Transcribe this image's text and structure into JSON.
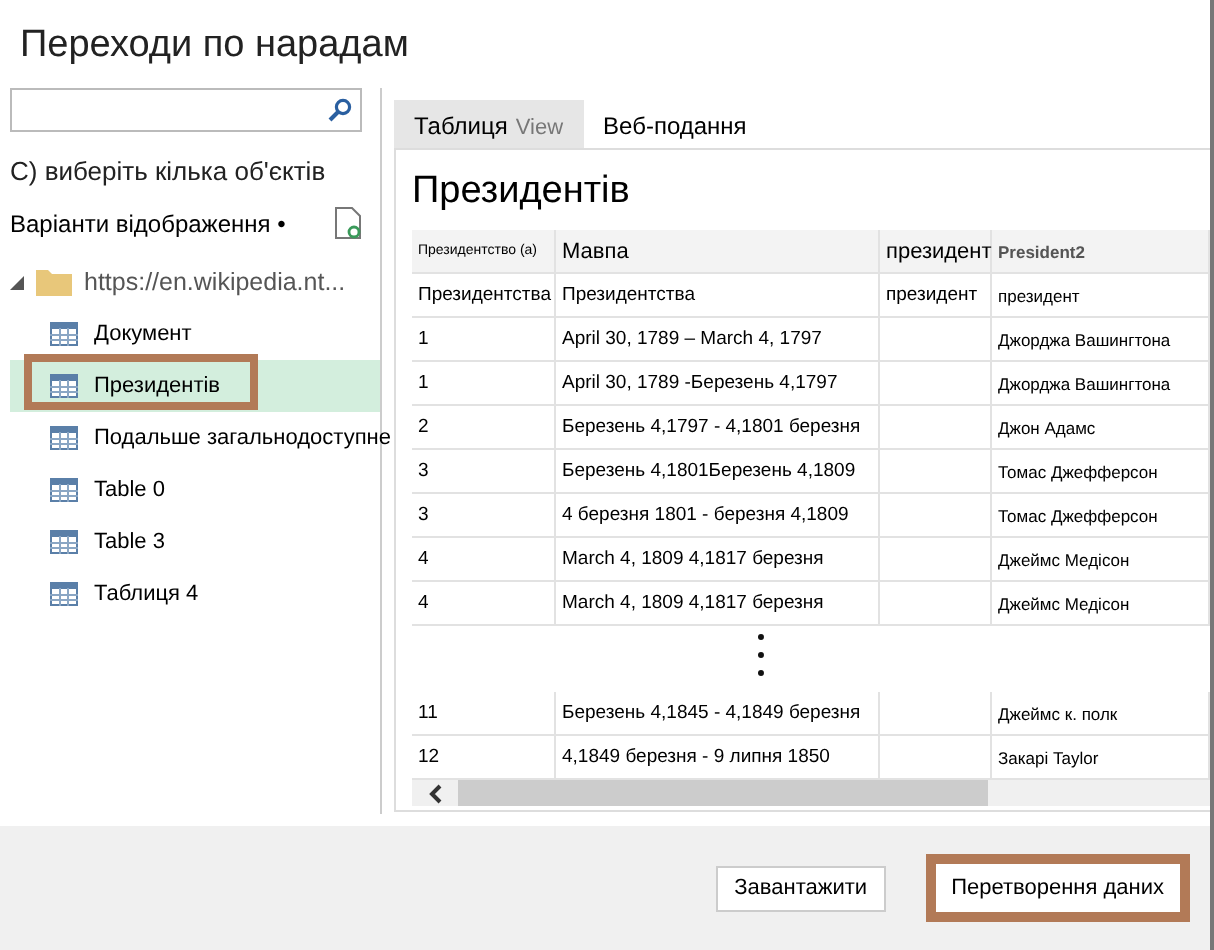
{
  "window": {
    "title": "Переходи по нарадам"
  },
  "select_multiple": "С) виберіть кілька об'єктів",
  "display_options": "Варіанти відображення •",
  "tree": [
    {
      "label": "https://en.wikipedia.nt...",
      "expanded": true,
      "children": [
        {
          "label": "Документ",
          "selected": false
        },
        {
          "label": "Президентів",
          "selected": true
        },
        {
          "label": "Подальше загальнодоступне",
          "selected": false
        },
        {
          "label": "Table 0",
          "selected": false
        },
        {
          "label": "Table 3",
          "selected": false
        },
        {
          "label": "Таблиця 4",
          "selected": false
        }
      ]
    }
  ],
  "tabs": [
    {
      "label": "Таблиця",
      "ghost": "View",
      "selected": true
    },
    {
      "label": "Веб-подання",
      "selected": false
    }
  ],
  "preview_title": "Президентів",
  "table": {
    "columns": [
      "Президентство (а)",
      "Мавпа",
      "президент",
      "President2"
    ],
    "rows": [
      [
        "Президентства",
        "Президентства",
        "президент",
        "президент"
      ],
      [
        "1",
        "April 30, 1789 – March 4, 1797",
        "",
        "Джорджа Вашингтона"
      ],
      [
        "1",
        "April 30, 1789 -Березень 4,1797",
        "",
        "Джорджа Вашингтона"
      ],
      [
        "2",
        "Березень 4,1797 - 4,1801 березня",
        "",
        "Джон Адамс"
      ],
      [
        "3",
        "Березень 4,1801Березень 4,1809",
        "",
        "Томас Джефферсон"
      ],
      [
        "3",
        "4 березня 1801 - березня 4,1809",
        "",
        "Томас Джефферсон"
      ],
      [
        "4",
        "March 4, 1809 4,1817 березня",
        "",
        "Джеймс Медісон"
      ],
      [
        "4",
        "March 4, 1809 4,1817 березня",
        "",
        "Джеймс Медісон"
      ]
    ],
    "more_rows": [
      [
        "11",
        "Березень 4,1845 - 4,1849 березня",
        "",
        "Джеймс к. полк"
      ],
      [
        "12",
        "4,1849 березня - 9 липня 1850",
        "",
        "Закарі Taylor"
      ]
    ]
  },
  "buttons": [
    {
      "label": "Завантажити",
      "highlighted": false
    },
    {
      "label": "Перетворення даних",
      "highlighted": true
    }
  ]
}
